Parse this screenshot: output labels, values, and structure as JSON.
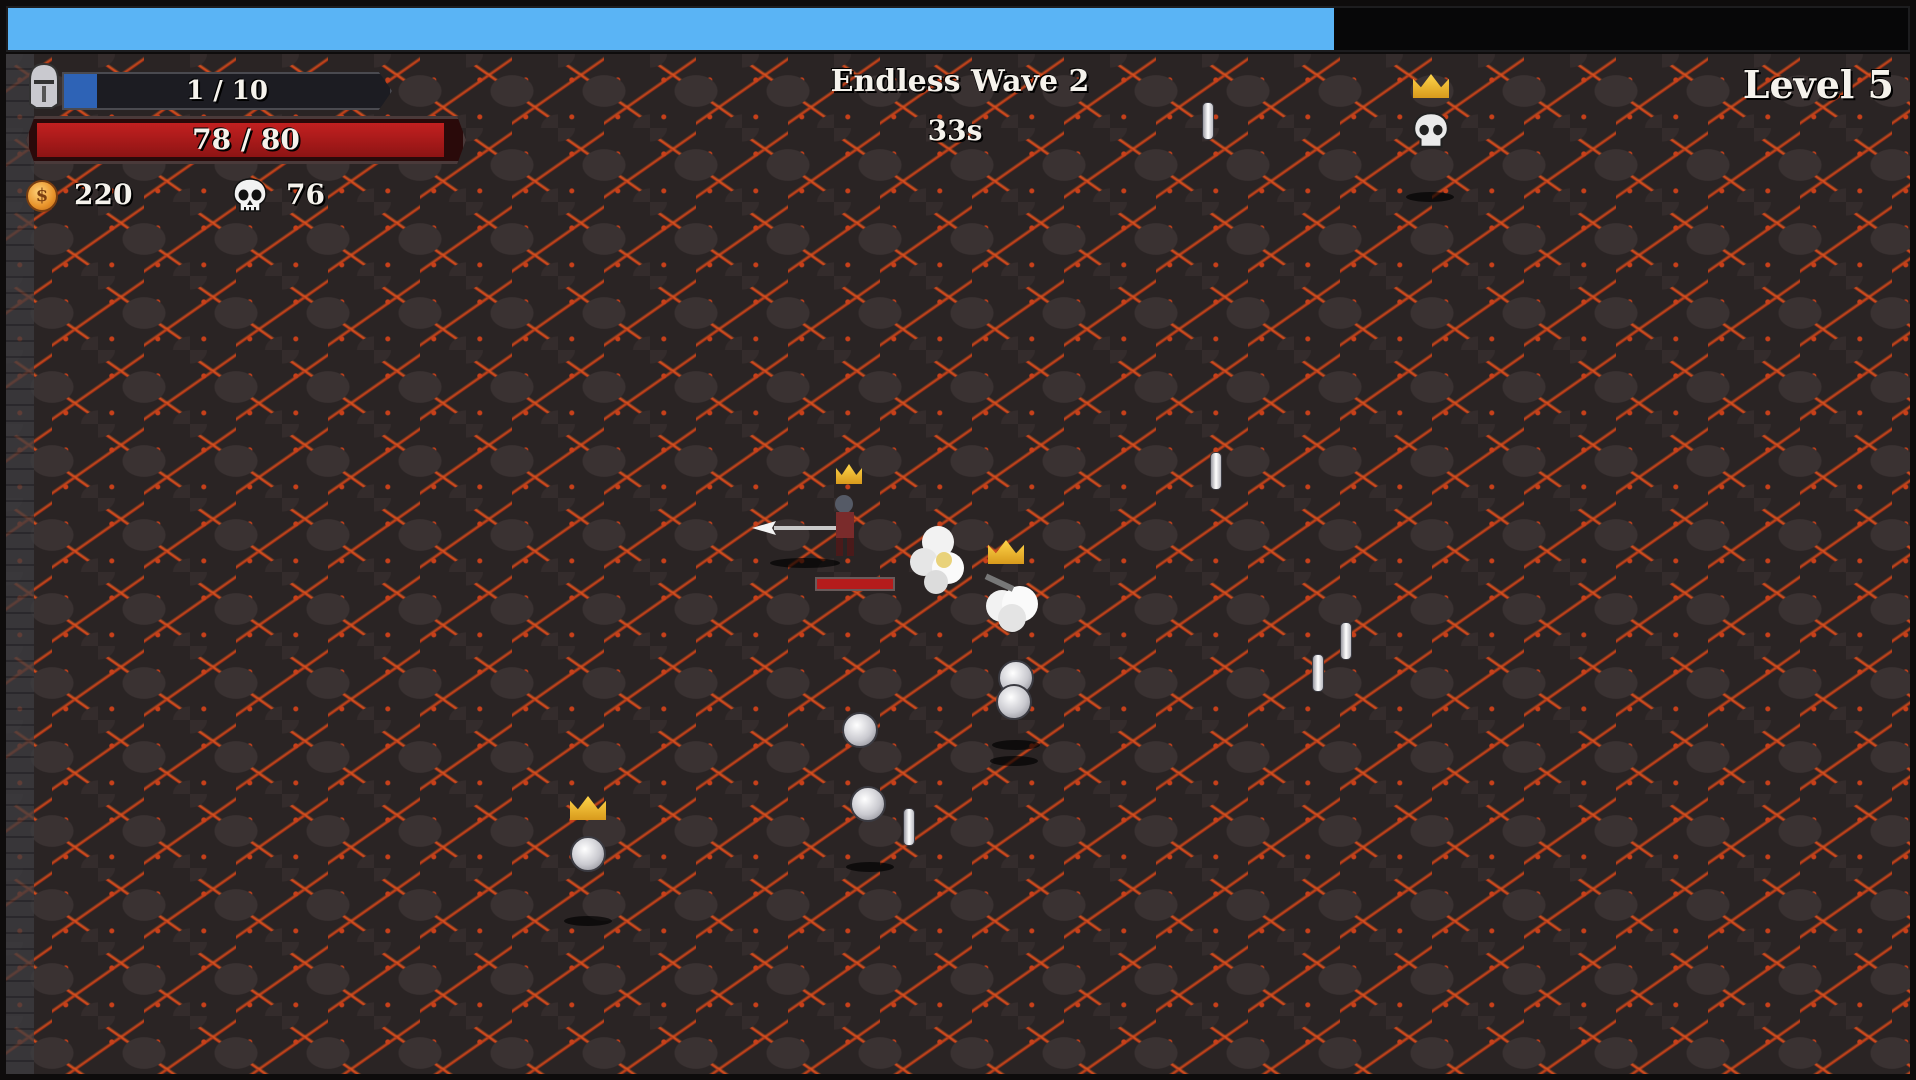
{
  "hud": {
    "xp_fill_fraction": 0.698,
    "armor": {
      "text": "1 / 10",
      "fill_fraction": 0.1,
      "icon": "helmet-icon"
    },
    "health": {
      "text": "78 / 80",
      "fill_fraction": 0.975
    },
    "coins": {
      "value": "220",
      "icon": "coin-icon"
    },
    "kills": {
      "value": "76",
      "icon": "skull-icon"
    },
    "wave": {
      "title": "Endless Wave 2",
      "timer": "33s"
    },
    "level": "Level 5"
  },
  "colors": {
    "xp_bar": "#5ab4f5",
    "armor_bar": "#2e63b6",
    "health_bar": "#c32020",
    "lava_cracks": "#d8541f",
    "rock": "#2a2424"
  },
  "coin_symbol": "$"
}
